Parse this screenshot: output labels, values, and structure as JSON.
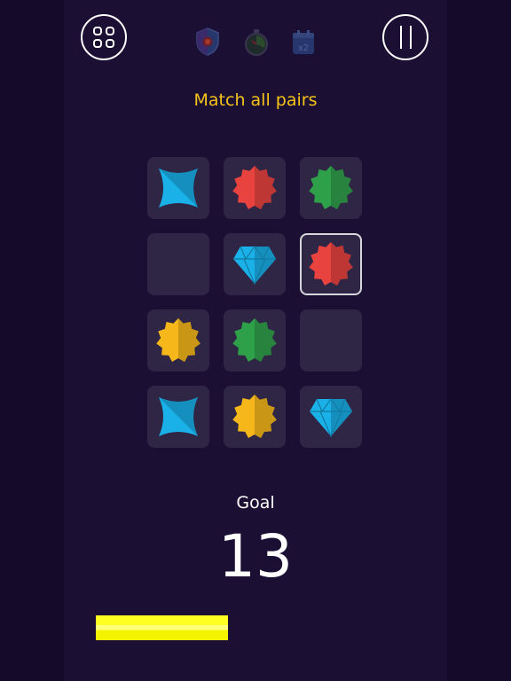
{
  "header": {
    "menu_icon": "grid-icon",
    "pause_icon": "pause-icon",
    "powerups": [
      {
        "icon": "shield-icon",
        "color": "#2a3f7a"
      },
      {
        "icon": "stopwatch-icon",
        "color": "#2e4a3a"
      },
      {
        "icon": "double-calendar-icon",
        "label": "x2",
        "color": "#2a3f7a"
      }
    ]
  },
  "instruction": "Match all pairs",
  "board": {
    "rows": 4,
    "cols": 3,
    "tiles": [
      {
        "shape": "four-point-star",
        "color": "#1ab0e8"
      },
      {
        "shape": "badge-star",
        "color": "#e8433f"
      },
      {
        "shape": "badge-star",
        "color": "#2fa04a"
      },
      {
        "shape": "empty"
      },
      {
        "shape": "diamond",
        "color": "#1ab0e8"
      },
      {
        "shape": "badge-star",
        "color": "#e8433f",
        "selected": true
      },
      {
        "shape": "badge-star",
        "color": "#f6b71a"
      },
      {
        "shape": "badge-star",
        "color": "#2fa04a"
      },
      {
        "shape": "empty"
      },
      {
        "shape": "four-point-star",
        "color": "#1ab0e8"
      },
      {
        "shape": "badge-star",
        "color": "#f6b71a"
      },
      {
        "shape": "diamond",
        "color": "#1ab0e8"
      }
    ]
  },
  "goal": {
    "label": "Goal",
    "value": "13"
  },
  "progress": {
    "fraction": 0.415,
    "color": "#ffff22"
  }
}
